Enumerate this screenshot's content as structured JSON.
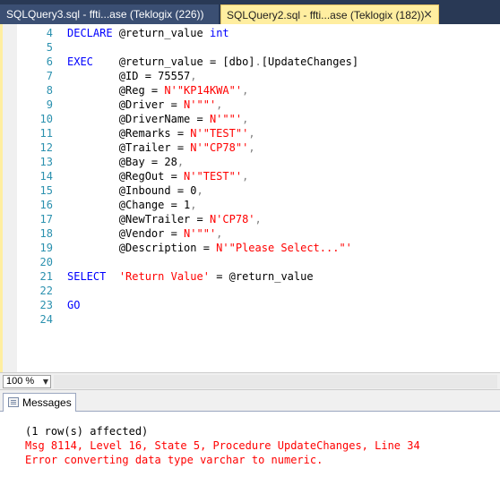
{
  "tabs": [
    {
      "label": "SQLQuery3.sql - ffti...ase (Teklogix (226))",
      "active": false
    },
    {
      "label": "SQLQuery2.sql - ffti...ase (Teklogix (182))",
      "active": true,
      "close_glyph": "×"
    }
  ],
  "code": {
    "line_numbers": [
      "4",
      "5",
      "6",
      "7",
      "8",
      "9",
      "10",
      "11",
      "12",
      "13",
      "14",
      "15",
      "16",
      "17",
      "18",
      "19",
      "20",
      "21",
      "22",
      "23",
      "24"
    ],
    "l4": {
      "kw": "DECLARE",
      "a": "@return_value",
      "b": "int"
    },
    "l6": {
      "kw": "EXEC",
      "a": "@return_value = ",
      "b": "[dbo]",
      "c": ".",
      "d": "[UpdateChanges]"
    },
    "l7": {
      "a": "@ID = 75557",
      "b": ","
    },
    "l8": {
      "a": "@Reg = ",
      "b": "N'\"KP14KWA\"'",
      "c": ","
    },
    "l9": {
      "a": "@Driver = ",
      "b": "N'\"\"'",
      "c": ","
    },
    "l10": {
      "a": "@DriverName = ",
      "b": "N'\"\"'",
      "c": ","
    },
    "l11": {
      "a": "@Remarks = ",
      "b": "N'\"TEST\"'",
      "c": ","
    },
    "l12": {
      "a": "@Trailer = ",
      "b": "N'\"CP78\"'",
      "c": ","
    },
    "l13": {
      "a": "@Bay = 28",
      "b": ","
    },
    "l14": {
      "a": "@RegOut = ",
      "b": "N'\"TEST\"'",
      "c": ","
    },
    "l15": {
      "a": "@Inbound = 0",
      "b": ","
    },
    "l16": {
      "a": "@Change = 1",
      "b": ","
    },
    "l17": {
      "a": "@NewTrailer = ",
      "b": "N'CP78'",
      "c": ","
    },
    "l18": {
      "a": "@Vendor = ",
      "b": "N'\"\"'",
      "c": ","
    },
    "l19": {
      "a": "@Description = ",
      "b": "N'\"Please Select...\"'"
    },
    "l21": {
      "kw": "SELECT",
      "b": "'Return Value'",
      "c": " = @return_value"
    },
    "l23": {
      "kw": "GO"
    }
  },
  "zoom": {
    "value": "100 %"
  },
  "results": {
    "tab_label": "Messages",
    "lines": [
      "(1 row(s) affected)",
      "Msg 8114, Level 16, State 5, Procedure UpdateChanges, Line 34",
      "Error converting data type varchar to numeric."
    ]
  },
  "colors": {
    "tabbar_bg": "#293955",
    "active_tab_bg": "#FFEEA0",
    "line_number": "#2B91AF",
    "keyword": "#0000FF",
    "string": "#FF0000",
    "error_text": "#FF0000"
  }
}
